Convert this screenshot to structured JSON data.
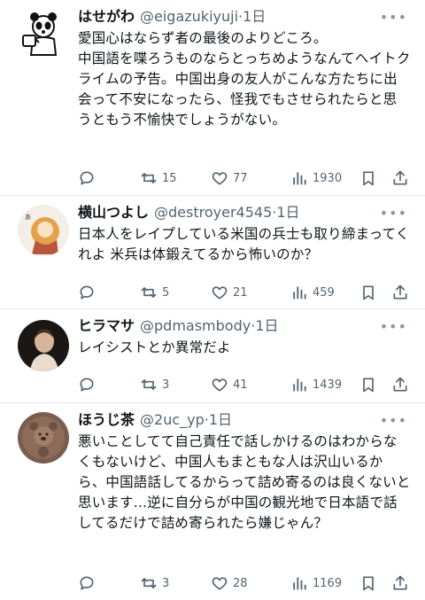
{
  "tweets": [
    {
      "name": "はせがわ",
      "handle": "@eigazukiyuji",
      "separator": "·",
      "time": "1日",
      "text": "愛国心はならず者の最後のよりどころ。\n中国語を喋ろうものならとっちめようなんてヘイトクライムの予告。中国出身の友人がこんな方たちに出会って不安になったら、怪我でもさせられたらと思うともう不愉快でしょうがない。",
      "replies": "",
      "retweets": "15",
      "likes": "77",
      "views": "1930",
      "avatar_icon": "panda-icon"
    },
    {
      "name": "横山つよし",
      "handle": "@destroyer4545",
      "separator": "·",
      "time": "1日",
      "text": "日本人をレイプしている米国の兵士も取り締まってくれよ 米兵は体鍛えてるから怖いのか？",
      "replies": "",
      "retweets": "5",
      "likes": "21",
      "views": "459",
      "avatar_icon": "illustration-avatar-icon"
    },
    {
      "name": "ヒラマサ",
      "handle": "@pdmasmbody",
      "separator": "·",
      "time": "1日",
      "text": "レイシストとか異常だよ",
      "replies": "",
      "retweets": "3",
      "likes": "41",
      "views": "1439",
      "avatar_icon": "portrait-avatar-icon"
    },
    {
      "name": "ほうじ茶",
      "handle": "@2uc_yp",
      "separator": "·",
      "time": "1日",
      "text": "悪いことしてて自己責任で話しかけるのはわからなくもないけど、中国人もまともな人は沢山いるから、中国語話してるからって詰め寄るのは良くないと思います...逆に自分らが中国の観光地で日本語で話してるだけで詰め寄られたら嫌じゃん？",
      "replies": "",
      "retweets": "3",
      "likes": "28",
      "views": "1169",
      "avatar_icon": "bear-avatar-icon"
    }
  ],
  "colors": {
    "text_primary": "#0f1419",
    "text_secondary": "#536471",
    "divider": "#e6e9ec"
  }
}
